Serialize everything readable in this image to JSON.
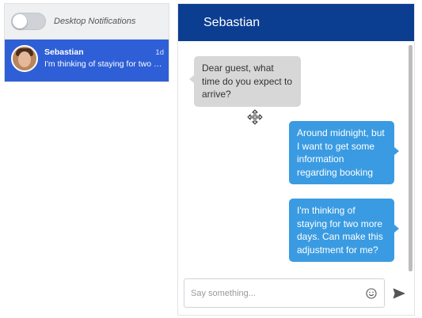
{
  "notifications": {
    "label": "Desktop Notifications",
    "enabled": false
  },
  "conversations": [
    {
      "name": "Sebastian",
      "time": "1d",
      "preview": "I'm thinking of staying for two mo..."
    }
  ],
  "chat": {
    "title": "Sebastian",
    "messages": [
      {
        "direction": "incoming",
        "text": "Dear guest, what time do you expect to arrive?"
      },
      {
        "direction": "outgoing",
        "text": "Around midnight, but I want to get some information regarding booking"
      },
      {
        "direction": "outgoing",
        "text": "I'm thinking of staying for two more days. Can make this adjustment for me?"
      }
    ],
    "composer": {
      "placeholder": "Say something..."
    }
  },
  "icons": {
    "avatar": "avatar-photo",
    "emoji": "smiley-icon",
    "send": "send-arrow-icon",
    "cursor": "move-cursor-icon"
  },
  "colors": {
    "header": "#0b3d91",
    "selected_conversation": "#2e5fd6",
    "outgoing_bubble": "#3a9be2",
    "incoming_bubble": "#d7d7d7"
  }
}
